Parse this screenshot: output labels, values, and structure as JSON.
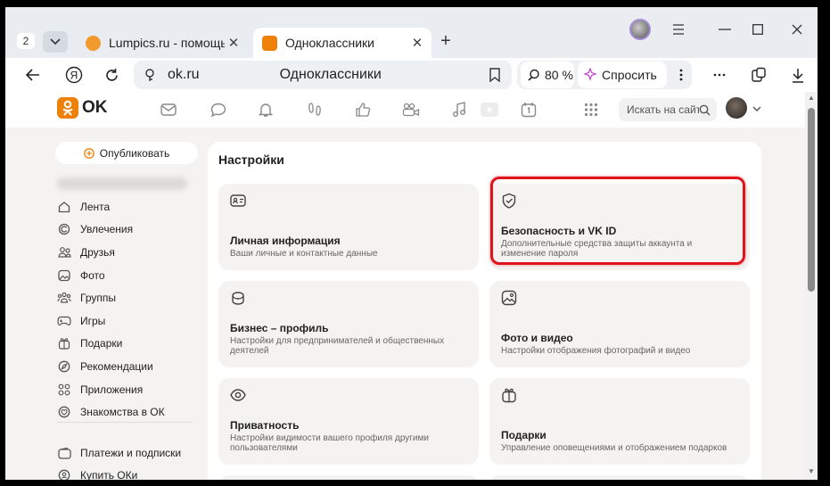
{
  "browser": {
    "tab_count": "2",
    "tabs": [
      {
        "title": "Lumpics.ru - помощь с к",
        "favicon_color": "#f29a2e"
      },
      {
        "title": "Одноклассники",
        "favicon_color": "#ee8208"
      }
    ],
    "url": "ok.ru",
    "page_title": "Одноклассники",
    "zoom": "80 %",
    "ask_label": "Спросить"
  },
  "ok": {
    "logo_text": "OK",
    "search_placeholder": "Искать на сайте",
    "publish_label": "Опубликовать",
    "sidebar": [
      {
        "label": "Лента",
        "icon": "home-icon"
      },
      {
        "label": "Увлечения",
        "icon": "hobby-icon"
      },
      {
        "label": "Друзья",
        "icon": "friends-icon"
      },
      {
        "label": "Фото",
        "icon": "photo-icon"
      },
      {
        "label": "Группы",
        "icon": "groups-icon"
      },
      {
        "label": "Игры",
        "icon": "gamepad-icon"
      },
      {
        "label": "Подарки",
        "icon": "gift-icon"
      },
      {
        "label": "Рекомендации",
        "icon": "compass-icon"
      },
      {
        "label": "Приложения",
        "icon": "apps-icon"
      },
      {
        "label": "Знакомства в ОК",
        "icon": "dating-icon"
      },
      {
        "label": "Платежи и подписки",
        "icon": "wallet-icon"
      },
      {
        "label": "Купить ОКи",
        "icon": "coin-icon"
      }
    ],
    "settings": {
      "title": "Настройки",
      "cards": [
        {
          "title": "Личная информация",
          "desc": "Ваши личные и контактные данные",
          "icon": "id-card-icon"
        },
        {
          "title": "Безопасность и VK ID",
          "desc": "Дополнительные средства защиты аккаунта и изменение пароля",
          "icon": "shield-icon"
        },
        {
          "title": "Бизнес – профиль",
          "desc": "Настройки для предпринимателей и общественных деятелей",
          "icon": "briefcase-icon"
        },
        {
          "title": "Фото и видео",
          "desc": "Настройки отображения фотографий и видео",
          "icon": "photo-icon"
        },
        {
          "title": "Приватность",
          "desc": "Настройки видимости вашего профиля другими пользователями",
          "icon": "eye-icon"
        },
        {
          "title": "Подарки",
          "desc": "Управление оповещениями и отображением подарков",
          "icon": "gift-icon"
        }
      ]
    }
  },
  "colors": {
    "accent": "#ee8208",
    "highlight": "#e0141c"
  }
}
